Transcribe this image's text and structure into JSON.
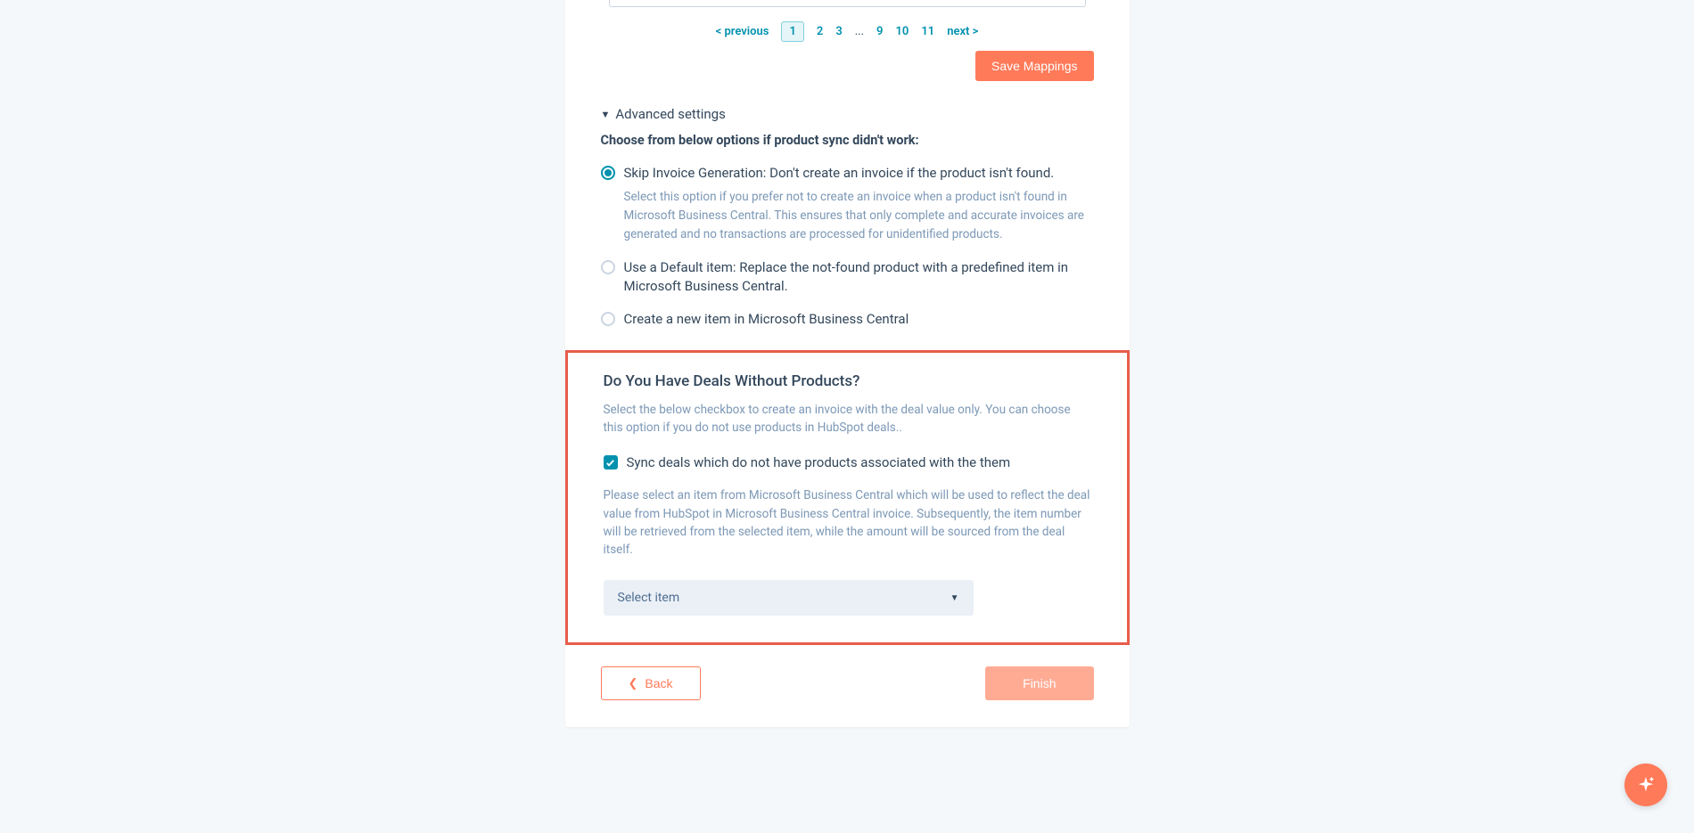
{
  "pagination": {
    "prev": "< previous",
    "pages": [
      "1",
      "2",
      "3",
      "...",
      "9",
      "10",
      "11"
    ],
    "current": "1",
    "next": "next >"
  },
  "buttons": {
    "save_mappings": "Save Mappings",
    "back": "Back",
    "finish": "Finish"
  },
  "advanced": {
    "header": "Advanced settings",
    "choose_text": "Choose from below options if product sync didn't work:",
    "options": [
      {
        "label": "Skip Invoice Generation: Don't create an invoice if the product isn't found.",
        "desc": "Select this option if you prefer not to create an invoice when a product isn't found in Microsoft Business Central. This ensures that only complete and accurate invoices are generated and no transactions are processed for unidentified products."
      },
      {
        "label": "Use a Default item: Replace the not-found product with a predefined item in Microsoft Business Central."
      },
      {
        "label": "Create a new item in Microsoft Business Central"
      }
    ]
  },
  "highlight": {
    "heading": "Do You Have Deals Without Products?",
    "desc": "Select the below checkbox to create an invoice with the deal value only. You can choose this option if you do not use products in HubSpot deals..",
    "checkbox_label": "Sync deals which do not have products associated with the them",
    "sub_desc": "Please select an item from Microsoft Business Central which will be used to reflect the deal value from HubSpot in Microsoft Business Central invoice. Subsequently, the item number will be retrieved from the selected item, while the amount will be sourced from the deal itself.",
    "select_placeholder": "Select item"
  }
}
